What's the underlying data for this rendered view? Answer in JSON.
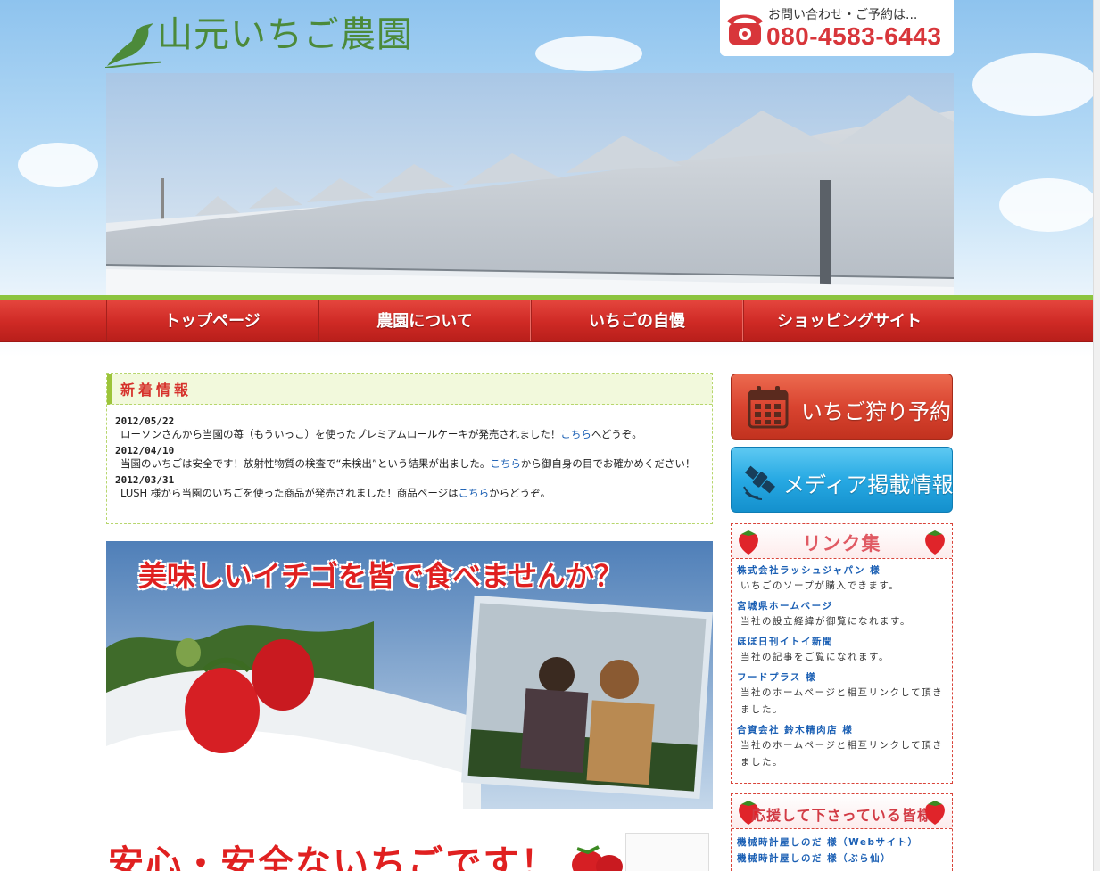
{
  "header": {
    "logo_text": "山元いちご農園",
    "phone_caption": "お問い合わせ・ご予約は...",
    "phone_number": "080-4583-6443"
  },
  "nav": {
    "items": [
      {
        "label": "トップページ"
      },
      {
        "label": "農園について"
      },
      {
        "label": "いちごの自慢"
      },
      {
        "label": "ショッピングサイト"
      }
    ]
  },
  "news": {
    "title": "新着情報",
    "items": [
      {
        "date": "2012/05/22",
        "text_before": "ローソンさんから当園の苺（もういっこ）を使ったプレミアムロールケーキが発売されました！",
        "link": "こちら",
        "text_after": "へどうぞ。"
      },
      {
        "date": "2012/04/10",
        "text_before": "当園のいちごは安全です！放射性物質の検査で“未検出”という結果が出ました。",
        "link": "こちら",
        "text_after": "から御自身の目でお確かめください！"
      },
      {
        "date": "2012/03/31",
        "text_before": "LUSH 様から当園のいちごを使った商品が発売されました！商品ページは",
        "link": "こちら",
        "text_after": "からどうぞ。"
      }
    ]
  },
  "banners": {
    "eat_together": "美味しいイチゴを皆で食べませんか？",
    "safe": "安心・安全ないちごです！"
  },
  "sidebar": {
    "reserve_label": "いちご狩り予約",
    "media_label": "メディア掲載情報",
    "links_title": "リンク集",
    "links": [
      {
        "name": "株式会社ラッシュジャパン 様",
        "desc": "いちごのソープが購入できます。"
      },
      {
        "name": "宮城県ホームページ",
        "desc": "当社の設立経緯が御覧になれます。"
      },
      {
        "name": "ほぼ日刊イトイ新聞",
        "desc": "当社の記事をご覧になれます。"
      },
      {
        "name": "フードプラス 様",
        "desc": "当社のホームページと相互リンクして頂きました。"
      },
      {
        "name": "合資会社 鈴木精肉店 様",
        "desc": "当社のホームページと相互リンクして頂きました。"
      }
    ],
    "supporters_title": "応援して下さっている皆様",
    "supporters": [
      {
        "name": "機械時計屋しのだ 様（Webサイト）"
      },
      {
        "name": "機械時計屋しのだ 様（ぶら仙）"
      }
    ]
  },
  "colors": {
    "brand_green": "#4c8a3a",
    "nav_red": "#cf2a25",
    "link_blue": "#1a5fb4",
    "phone_red": "#d8363b"
  }
}
